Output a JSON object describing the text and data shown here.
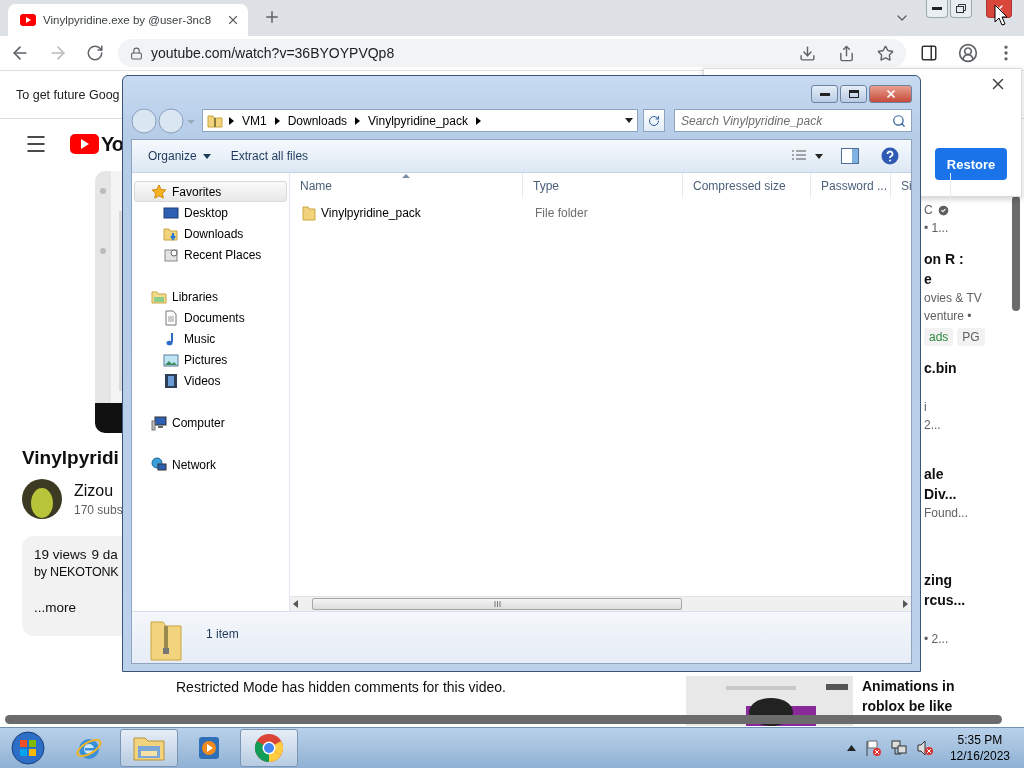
{
  "browser": {
    "tabs": [
      {
        "title": "Vinylpyridine.exe by @user-3nc8",
        "selected": true
      }
    ],
    "address": "youtube.com/watch?v=36BYOYPVQp8"
  },
  "page": {
    "infobar": "To get future Goog",
    "logo_text": "Yo",
    "video_title": "Vinylpyridi",
    "channel_name": "Zizou",
    "subscribers": "170 subs",
    "description": {
      "views": "19 views",
      "date": "9 da",
      "byline": "by NEKOTONK",
      "more": "...more"
    },
    "comments_notice": "Restricted Mode has hidden comments for this video.",
    "recommendations": [
      {
        "lines": [
          {
            "kind": "channel",
            "text": "C"
          },
          {
            "kind": "meta",
            "text": "• 1..."
          }
        ]
      },
      {
        "lines": [
          {
            "kind": "title",
            "text": "on R :"
          },
          {
            "kind": "title",
            "text": "e"
          },
          {
            "kind": "meta",
            "text": "ovies & TV"
          },
          {
            "kind": "meta",
            "text": "venture •"
          },
          {
            "kind": "badges",
            "badges": [
              {
                "text": "ads",
                "kind": "green"
              },
              {
                "text": "PG",
                "kind": "plain"
              }
            ]
          }
        ]
      },
      {
        "lines": [
          {
            "kind": "title",
            "text": "c.bin"
          },
          {
            "kind": "gap"
          },
          {
            "kind": "meta",
            "text": "i"
          },
          {
            "kind": "meta",
            "text": "2..."
          }
        ]
      },
      {
        "lines": [
          {
            "kind": "title",
            "text": "ale"
          },
          {
            "kind": "title",
            "text": "Div..."
          },
          {
            "kind": "meta",
            "text": "Found..."
          }
        ]
      },
      {
        "lines": [
          {
            "kind": "title",
            "text": "zing"
          },
          {
            "kind": "title",
            "text": "rcus..."
          },
          {
            "kind": "gap"
          },
          {
            "kind": "meta",
            "text": "• 2..."
          }
        ]
      },
      {
        "thumbnail": {
          "kind": "picture"
        },
        "lines": [
          {
            "kind": "title",
            "text": "Animations in"
          },
          {
            "kind": "title",
            "text": "roblox be like"
          }
        ]
      }
    ]
  },
  "restore_popup": {
    "button": "Restore"
  },
  "explorer": {
    "breadcrumb": [
      "VM1",
      "Downloads",
      "Vinylpyridine_pack"
    ],
    "search": {
      "placeholder": "Search Vinylpyridine_pack"
    },
    "commands": [
      {
        "label": "Organize",
        "menu": true
      },
      {
        "label": "Extract all files",
        "menu": false
      }
    ],
    "nav": [
      {
        "label": "Favorites",
        "kind": "star",
        "selected": true,
        "children": [
          {
            "label": "Desktop",
            "kind": "desktop",
            "selected": false
          },
          {
            "label": "Downloads",
            "kind": "downloads",
            "selected": false
          },
          {
            "label": "Recent Places",
            "kind": "recent",
            "selected": false
          }
        ]
      },
      {
        "label": "Libraries",
        "kind": "libraries",
        "selected": false,
        "children": [
          {
            "label": "Documents",
            "kind": "documents",
            "selected": false
          },
          {
            "label": "Music",
            "kind": "music",
            "selected": false
          },
          {
            "label": "Pictures",
            "kind": "pictures",
            "selected": false
          },
          {
            "label": "Videos",
            "kind": "videos",
            "selected": false
          }
        ]
      },
      {
        "label": "Computer",
        "kind": "computer",
        "selected": false
      },
      {
        "label": "Network",
        "kind": "network",
        "selected": false
      }
    ],
    "columns": [
      {
        "label": "Name",
        "sorted": true
      },
      {
        "label": "Type",
        "sorted": false
      },
      {
        "label": "Compressed size",
        "sorted": false
      },
      {
        "label": "Password ...",
        "sorted": false
      },
      {
        "label": "Si",
        "sorted": false
      }
    ],
    "files": [
      {
        "name": "Vinylpyridine_pack",
        "type": "File folder",
        "kind": "folder"
      }
    ],
    "status": "1 item"
  },
  "taskbar": {
    "apps": [
      {
        "kind": "ie",
        "active": false
      },
      {
        "kind": "explorer",
        "active": true
      },
      {
        "kind": "media",
        "active": false
      },
      {
        "kind": "chrome",
        "active": true
      }
    ],
    "time": "5:35 PM",
    "date": "12/16/2023"
  }
}
